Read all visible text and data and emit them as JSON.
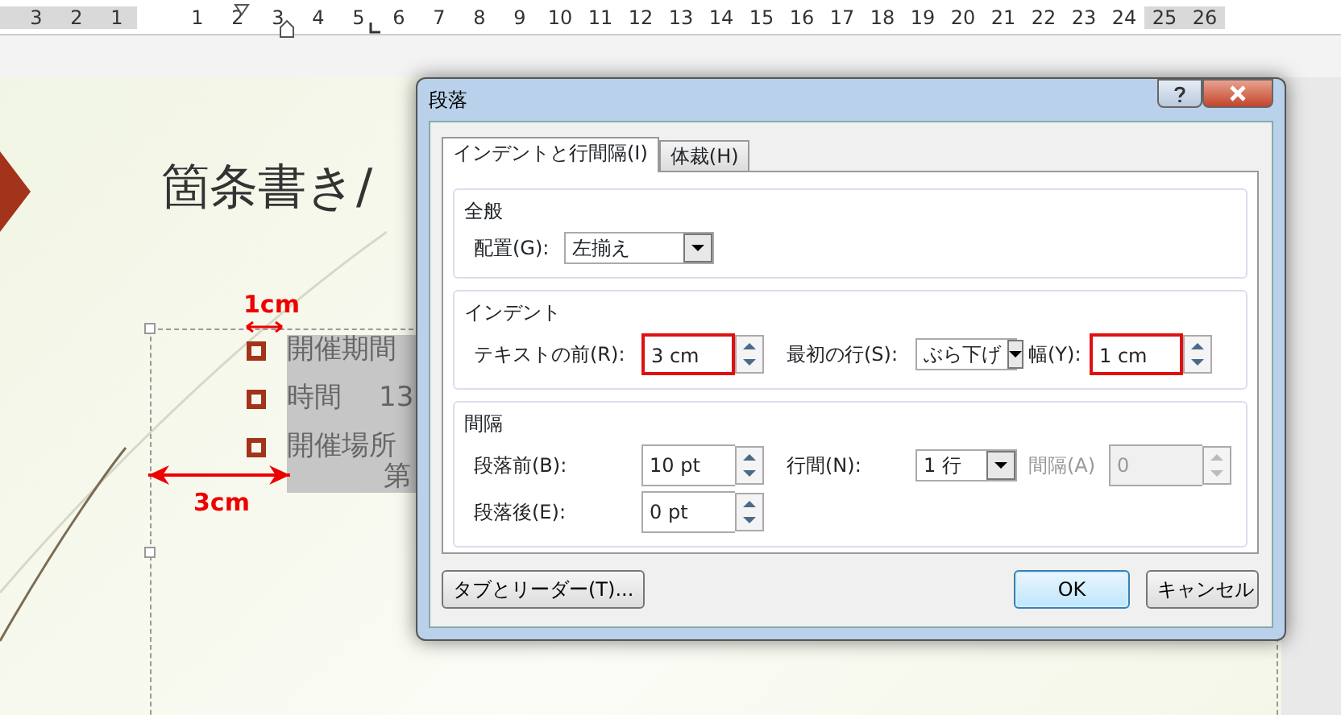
{
  "ruler": {
    "left_numbers": [
      "3",
      "2",
      "1"
    ],
    "right_numbers": [
      "1",
      "2",
      "3",
      "4",
      "5",
      "6",
      "7",
      "8",
      "9",
      "10",
      "11",
      "12",
      "13",
      "14",
      "15",
      "16",
      "17",
      "18",
      "19",
      "20",
      "21",
      "22",
      "23",
      "24",
      "25",
      "26"
    ]
  },
  "slide": {
    "title": "箇条書き/",
    "bullets": [
      {
        "text": "開催期間"
      },
      {
        "text": "時間",
        "extra": "13"
      },
      {
        "text": "開催場所"
      }
    ],
    "continuation": "第",
    "annotations": [
      {
        "kind": "hanging",
        "label": "1cm"
      },
      {
        "kind": "before",
        "label": "3cm"
      }
    ]
  },
  "dialog": {
    "title": "段落",
    "tabs": [
      {
        "label": "インデントと行間隔(I)",
        "selected": true
      },
      {
        "label": "体裁(H)",
        "selected": false
      }
    ],
    "groups": [
      {
        "title": "全般",
        "rows": [
          {
            "items": [
              {
                "kind": "label",
                "text": "配置(G):",
                "disabled": false
              },
              {
                "kind": "select",
                "value": "左揃え",
                "disabled": false,
                "highlighted": false
              }
            ]
          }
        ]
      },
      {
        "title": "インデント",
        "rows": [
          {
            "items": [
              {
                "kind": "label",
                "text": "テキストの前(R):",
                "disabled": false
              },
              {
                "kind": "spin",
                "value": "3 cm",
                "disabled": false,
                "highlighted": true
              },
              {
                "kind": "label",
                "text": "最初の行(S):",
                "disabled": false
              },
              {
                "kind": "select",
                "value": "ぶら下げ",
                "disabled": false,
                "highlighted": false
              },
              {
                "kind": "label",
                "text": "幅(Y):",
                "disabled": false
              },
              {
                "kind": "spin",
                "value": "1 cm",
                "disabled": false,
                "highlighted": true
              }
            ]
          }
        ]
      },
      {
        "title": "間隔",
        "rows": [
          {
            "items": [
              {
                "kind": "label",
                "text": "段落前(B):",
                "disabled": false
              },
              {
                "kind": "spin",
                "value": "10 pt",
                "disabled": false,
                "highlighted": false
              },
              {
                "kind": "label",
                "text": "行間(N):",
                "disabled": false
              },
              {
                "kind": "select",
                "value": "1 行",
                "disabled": false,
                "highlighted": false
              },
              {
                "kind": "label",
                "text": "間隔(A)",
                "disabled": true
              },
              {
                "kind": "spin",
                "value": "0",
                "disabled": true,
                "highlighted": false
              }
            ]
          },
          {
            "items": [
              {
                "kind": "label",
                "text": "段落後(E):",
                "disabled": false
              },
              {
                "kind": "spin",
                "value": "0 pt",
                "disabled": false,
                "highlighted": false
              }
            ]
          }
        ]
      }
    ],
    "buttons": [
      {
        "kind": "tabs",
        "label": "タブとリーダー(T)..."
      },
      {
        "kind": "ok",
        "label": "OK"
      },
      {
        "kind": "cancel",
        "label": "キャンセル"
      }
    ]
  }
}
